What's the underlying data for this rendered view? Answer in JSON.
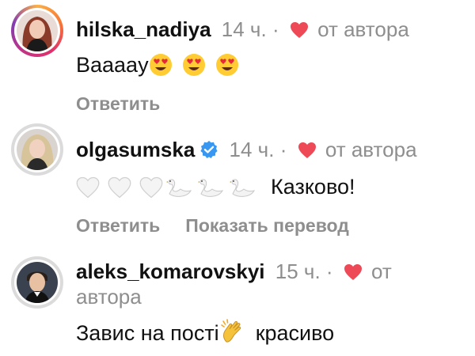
{
  "comments": [
    {
      "username": "hilska_nadiya",
      "verified": false,
      "time": "14 ч.",
      "separator": "·",
      "liked_by_author": "от автора",
      "text": "Вааааy",
      "emoji": [
        "heart-eyes-emoji",
        "heart-eyes-emoji",
        "heart-eyes-emoji"
      ],
      "reply_label": "Ответить"
    },
    {
      "username": "olgasumska",
      "verified": true,
      "time": "14 ч.",
      "separator": "·",
      "liked_by_author": "от автора",
      "text": "Казково!",
      "emoji": [
        "white-heart-emoji",
        "white-heart-emoji",
        "white-heart-emoji",
        "swan-emoji",
        "swan-emoji",
        "swan-emoji"
      ],
      "reply_label": "Ответить",
      "translate_label": "Показать перевод"
    },
    {
      "username": "aleks_komarovskyi",
      "verified": false,
      "time": "15 ч.",
      "separator": "·",
      "liked_by_author_1": "от",
      "liked_by_author_2": "автора",
      "text_before": "Завис на пості",
      "text_after": "красиво",
      "emoji": [
        "clapping-hands-emoji"
      ]
    }
  ],
  "colors": {
    "heart": "#ed4956",
    "verified": "#3897f0",
    "meta_text": "#8e8e8e",
    "text": "#111111"
  }
}
